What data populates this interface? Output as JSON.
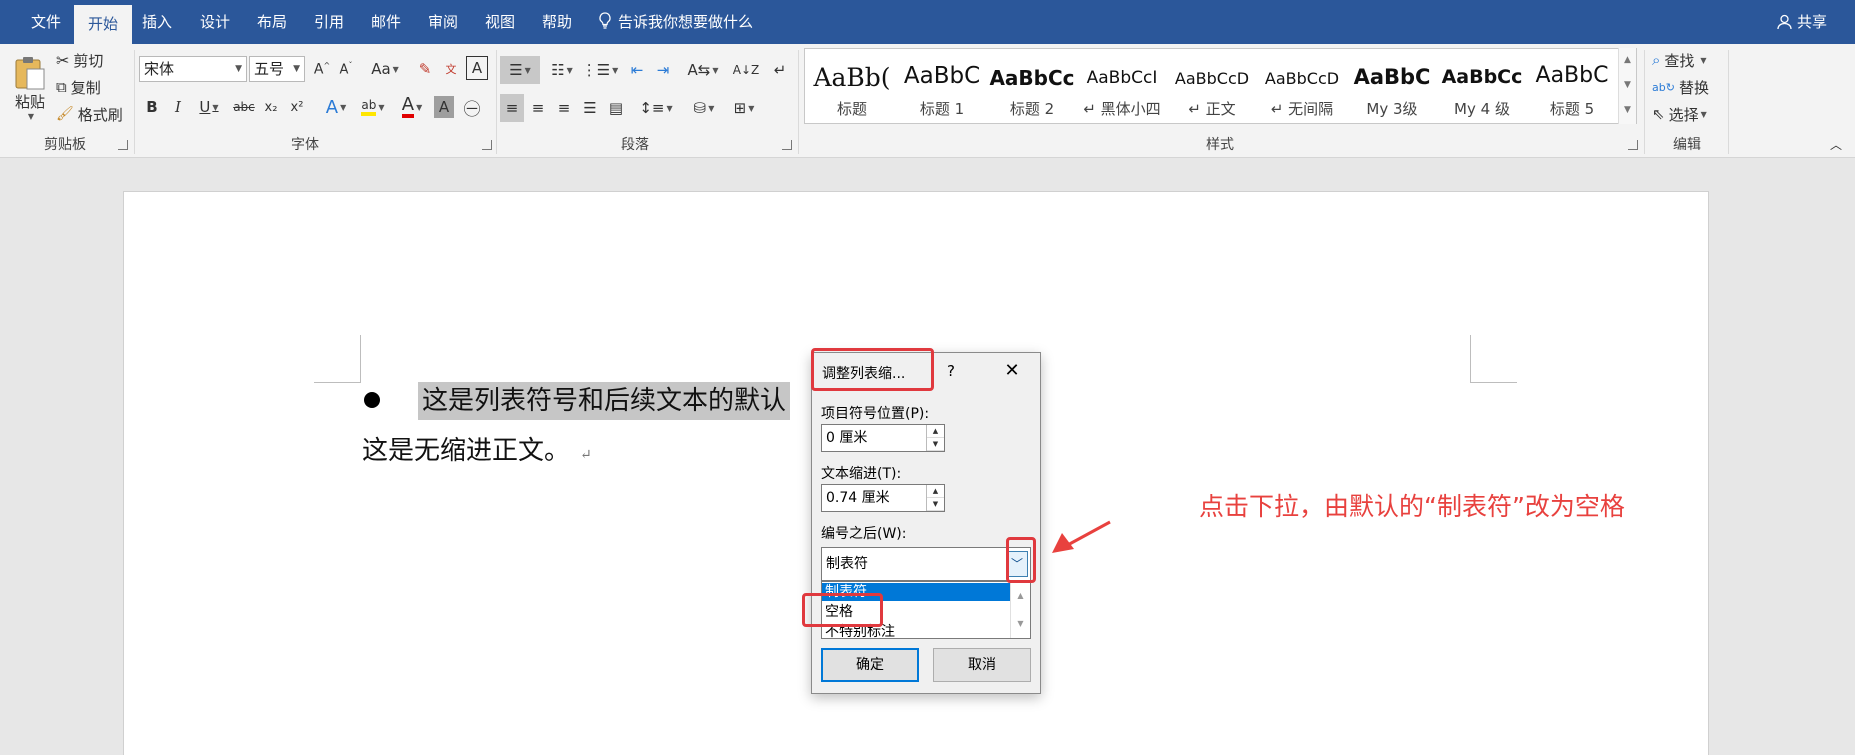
{
  "tabs": [
    "文件",
    "开始",
    "插入",
    "设计",
    "布局",
    "引用",
    "邮件",
    "审阅",
    "视图",
    "帮助"
  ],
  "tell_me": "告诉我你想要做什么",
  "share": "共享",
  "clipboard": {
    "paste": "粘贴",
    "cut": "剪切",
    "copy": "复制",
    "format_painter": "格式刷",
    "group": "剪贴板"
  },
  "font": {
    "name": "宋体",
    "size": "五号",
    "change_case": "Aa",
    "group": "字体"
  },
  "paragraph": {
    "group": "段落"
  },
  "styles": {
    "group": "样式",
    "items": [
      {
        "sample": "AaBb(",
        "name": "标题"
      },
      {
        "sample": "AaBbC",
        "name": "标题 1"
      },
      {
        "sample": "AaBbCc",
        "name": "标题 2"
      },
      {
        "sample": "AaBbCcI",
        "name": "↵ 黑体小四"
      },
      {
        "sample": "AaBbCcD",
        "name": "↵ 正文"
      },
      {
        "sample": "AaBbCcD",
        "name": "↵ 无间隔"
      },
      {
        "sample": "AaBbC",
        "name": "My 3级"
      },
      {
        "sample": "AaBbCc",
        "name": "My 4 级"
      },
      {
        "sample": "AaBbC",
        "name": "标题 5"
      }
    ]
  },
  "editing": {
    "find": "查找",
    "replace": "替换",
    "select": "选择",
    "group": "编辑"
  },
  "document": {
    "list_line": "这是列表符号和后续文本的默认",
    "plain_line": "这是无缩进正文。",
    "para_mark": "↵"
  },
  "dialog": {
    "title": "调整列表缩...",
    "help": "?",
    "bullet_position_label": "项目符号位置(P):",
    "bullet_position_value": "0 厘米",
    "text_indent_label": "文本缩进(T):",
    "text_indent_value": "0.74 厘米",
    "follow_label": "编号之后(W):",
    "follow_value": "制表符",
    "options": [
      "制表符",
      "空格",
      "不特别标注"
    ],
    "ok": "确定",
    "cancel": "取消"
  },
  "annotation": {
    "callout": "点击下拉，由默认的“制表符”改为空格",
    "color": "#e8413e"
  },
  "colors": {
    "ribbon_blue": "#2b579a",
    "selection": "#0078d7"
  }
}
